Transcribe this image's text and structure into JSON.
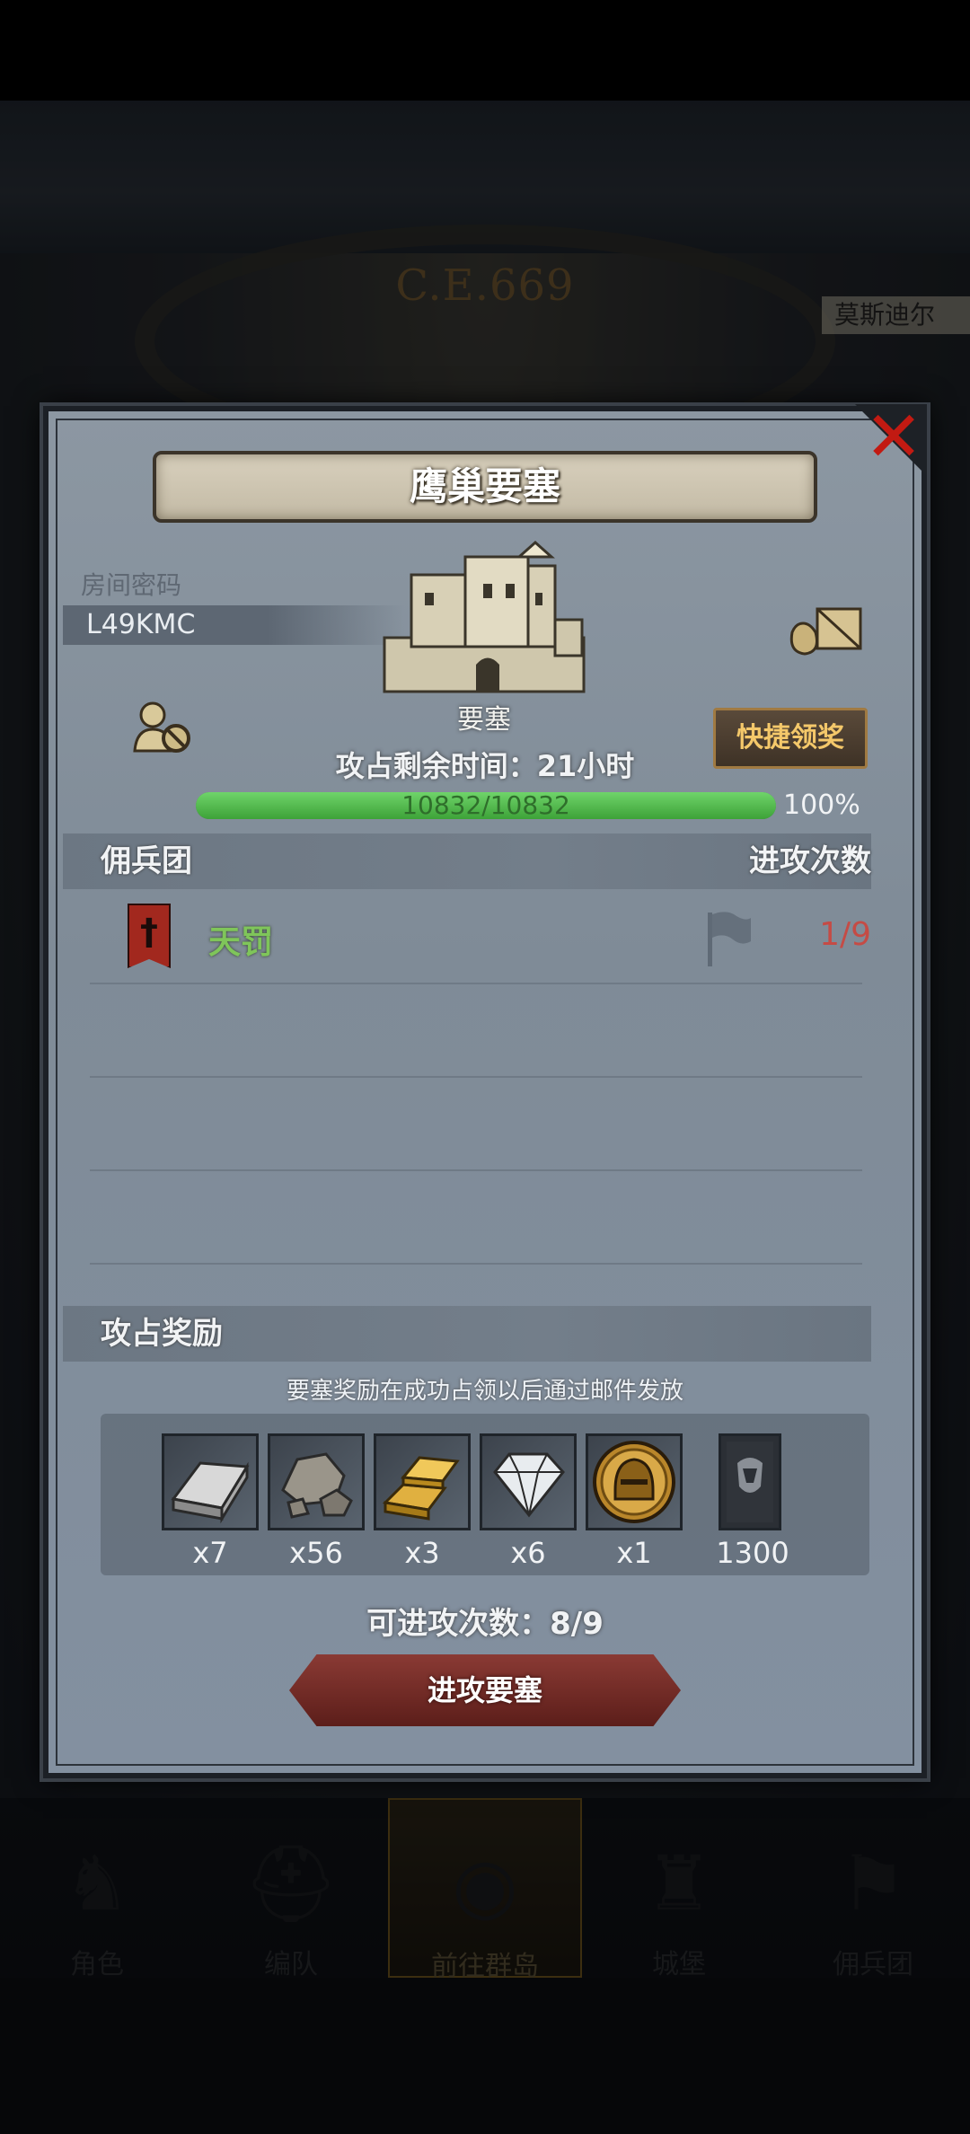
{
  "background": {
    "era_label": "C.E.669",
    "side_label": "莫斯迪尔"
  },
  "dialog": {
    "title": "鹰巢要塞",
    "close_icon": "close-icon",
    "room_code_label": "房间密码",
    "room_code": "L49KMC",
    "fortress_label": "要塞",
    "quick_claim_button": "快捷领奖",
    "remaining_time": "攻占剩余时间：21小时",
    "hp_text": "10832/10832",
    "hp_percent_label": "100%",
    "hp_fraction": 1.0,
    "mercenary_header": "佣兵团",
    "attack_count_header": "进攻次数",
    "guilds": [
      {
        "name": "天罚",
        "attacks": "1/9"
      }
    ],
    "reward_header": "攻占奖励",
    "reward_note": "要塞奖励在成功占领以后通过邮件发放",
    "rewards": [
      {
        "icon": "iron-ingot-icon",
        "qty": "x7"
      },
      {
        "icon": "stone-ore-icon",
        "qty": "x56"
      },
      {
        "icon": "gold-bars-icon",
        "qty": "x3"
      },
      {
        "icon": "diamond-icon",
        "qty": "x6"
      },
      {
        "icon": "knight-helmet-coin-icon",
        "qty": "x1"
      },
      {
        "icon": "mercenary-banner-icon",
        "qty": "1300"
      }
    ],
    "attempts_text": "可进攻次数：8/9",
    "attack_button": "进攻要塞"
  },
  "bottom_nav": [
    {
      "label": "角色",
      "icon": "knight-icon"
    },
    {
      "label": "编队",
      "icon": "helmet-icon"
    },
    {
      "label": "前往群岛",
      "icon": "globe-icon",
      "active": true
    },
    {
      "label": "城堡",
      "icon": "castle-icon"
    },
    {
      "label": "佣兵团",
      "icon": "banner-icon"
    }
  ],
  "colors": {
    "close_red": "#c21a12",
    "hp_green": "#4caf45",
    "guild_green": "#7fc55a",
    "attack_count_red": "#c54b45",
    "button_gold_text": "#f4c86a"
  }
}
